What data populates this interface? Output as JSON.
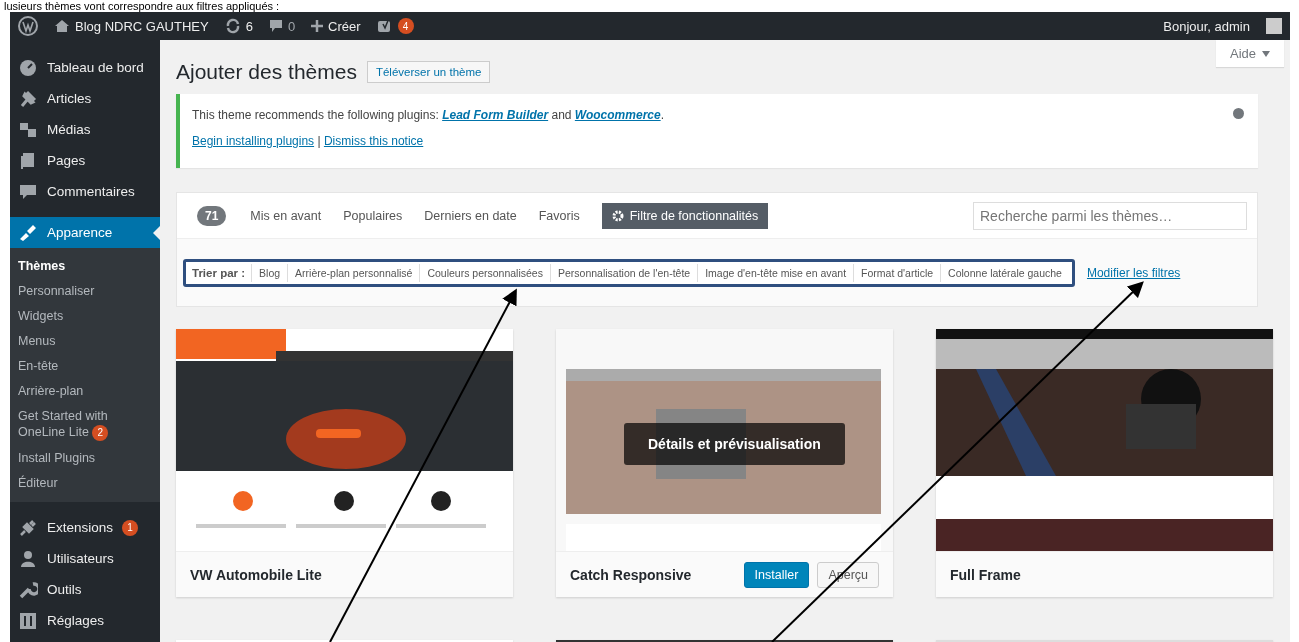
{
  "caption": "lusieurs thèmes vont correspondre aux filtres appliqués :",
  "admin_bar": {
    "site": "Blog NDRC GAUTHEY",
    "updates": "6",
    "comments": "0",
    "new": "Créer",
    "seo_badge": "4",
    "greeting": "Bonjour, admin"
  },
  "help_button": "Aide",
  "sidebar": {
    "items": [
      {
        "label": "Tableau de bord",
        "selected": false
      },
      {
        "label": "Articles",
        "selected": false
      },
      {
        "label": "Médias",
        "selected": false
      },
      {
        "label": "Pages",
        "selected": false
      },
      {
        "label": "Commentaires",
        "selected": false
      },
      {
        "label": "Apparence",
        "selected": true,
        "children": [
          {
            "label": "Thèmes",
            "selected": true
          },
          {
            "label": "Personnaliser",
            "selected": false
          },
          {
            "label": "Widgets",
            "selected": false
          },
          {
            "label": "Menus",
            "selected": false
          },
          {
            "label": "En-tête",
            "selected": false
          },
          {
            "label": "Arrière-plan",
            "selected": false
          },
          {
            "label": "Get Started with OneLine Lite",
            "badge": "2",
            "selected": false
          },
          {
            "label": "Install Plugins",
            "selected": false
          },
          {
            "label": "Éditeur",
            "selected": false
          }
        ]
      },
      {
        "label": "Extensions",
        "badge": "1",
        "selected": false
      },
      {
        "label": "Utilisateurs",
        "selected": false
      },
      {
        "label": "Outils",
        "selected": false
      },
      {
        "label": "Réglages",
        "selected": false
      }
    ]
  },
  "page_title": "Ajouter des thèmes",
  "upload_button": "Téléverser un thème",
  "notice": {
    "before": "This theme recommends the following plugins: ",
    "plugins": [
      "Lead Form Builder",
      "Woocommerce"
    ],
    "joiner": " and ",
    "after": ".",
    "actions": [
      "Begin installing plugins",
      "Dismiss this notice"
    ],
    "separator": "|"
  },
  "filter_bar": {
    "count": "71",
    "tabs": [
      {
        "label": "Mis en avant",
        "kind": "tab",
        "selected": false
      },
      {
        "label": "Populaires",
        "kind": "tab",
        "selected": false
      },
      {
        "label": "Derniers en date",
        "kind": "tab",
        "selected": false
      },
      {
        "label": "Favoris",
        "kind": "tab",
        "selected": false
      },
      {
        "label": "Filtre de fonctionnalités",
        "kind": "filter",
        "selected": true
      }
    ],
    "search": {
      "placeholder": "Recherche parmi les thèmes…"
    },
    "sort_label": "Trier par :",
    "tags": [
      "Blog",
      "Arrière-plan personnalisé",
      "Couleurs personnalisées",
      "Personnalisation de l'en-tête",
      "Image d'en-tête mise en avant",
      "Format d'article",
      "Colonne latérale gauche"
    ],
    "edit_link": "Modifier les filtres"
  },
  "themes": [
    {
      "name": "VW Automobile Lite",
      "hovered": false
    },
    {
      "name": "Catch Responsive",
      "hovered": true,
      "overlay": "Détails et prévisualisation",
      "actions": [
        {
          "label": "Installer",
          "kind": "primary"
        },
        {
          "label": "Aperçu",
          "kind": "secondary"
        }
      ]
    },
    {
      "name": "Full Frame",
      "hovered": false
    }
  ]
}
